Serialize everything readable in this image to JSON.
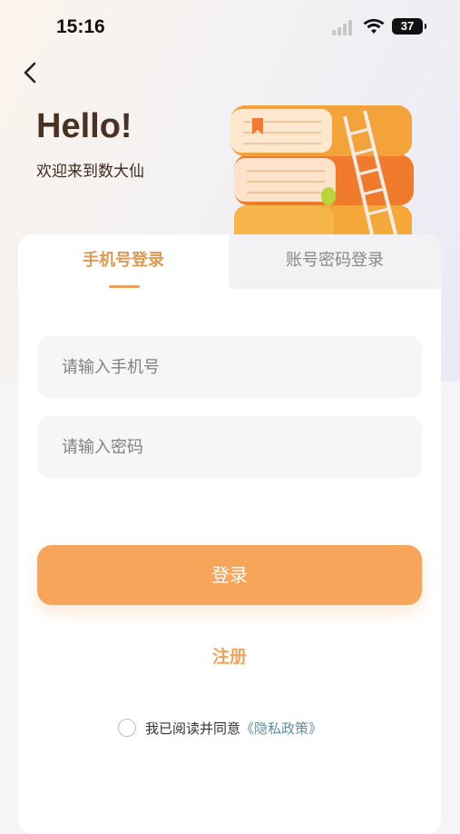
{
  "status_bar": {
    "time": "15:16",
    "battery": "37"
  },
  "header": {
    "hello": "Hello!",
    "welcome": "欢迎来到数大仙"
  },
  "tabs": [
    {
      "label": "手机号登录",
      "active": true
    },
    {
      "label": "账号密码登录",
      "active": false
    }
  ],
  "form": {
    "phone_placeholder": "请输入手机号",
    "password_placeholder": "请输入密码",
    "login_label": "登录",
    "register_label": "注册"
  },
  "agreement": {
    "text": "我已阅读并同意",
    "policy": "《隐私政策》"
  },
  "icons": {
    "back": "chevron-left-icon",
    "checkbox": "radio-circle-icon"
  },
  "colors": {
    "accent": "#f6a55a",
    "tab_active": "#dd9a52",
    "register": "#eea45a",
    "link": "#5e8fa4",
    "hello": "#4a3222"
  }
}
